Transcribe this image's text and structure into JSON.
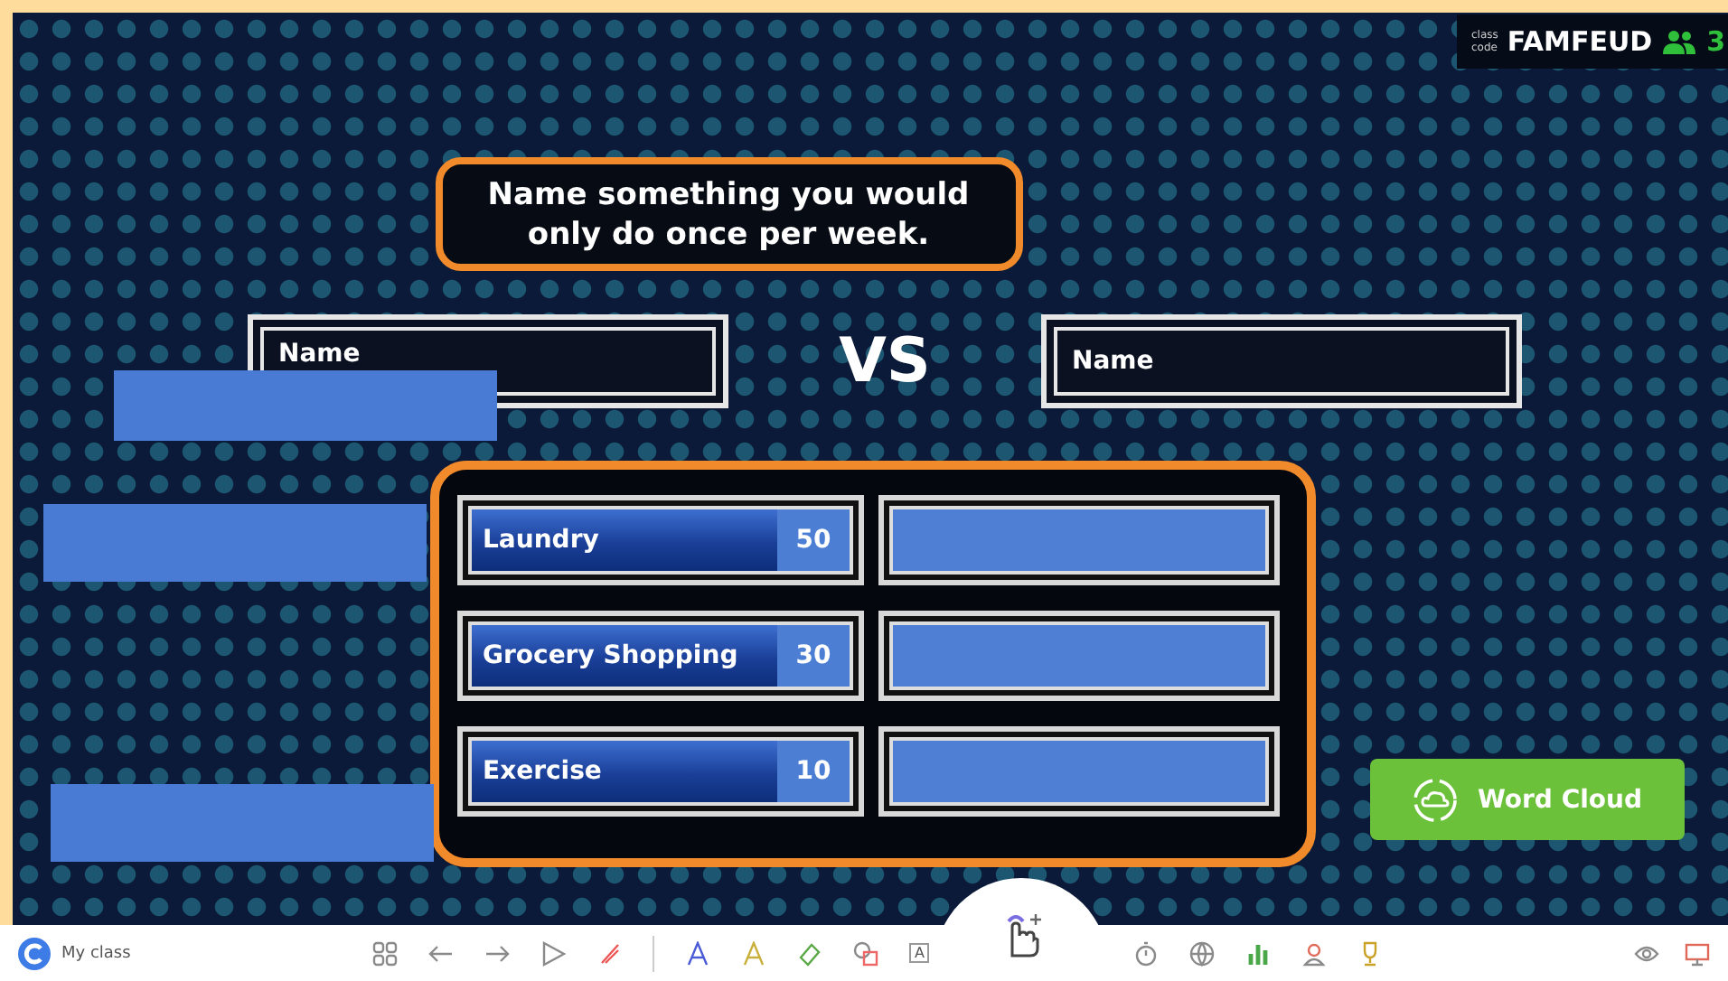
{
  "class_code": {
    "label_lines": [
      "class",
      "code"
    ],
    "code": "FAMFEUD",
    "count": "3"
  },
  "question": "Name something you would only do once per week.",
  "teams": [
    {
      "name": "Name"
    },
    {
      "name": "Name"
    }
  ],
  "vs": "VS",
  "answers": [
    {
      "text": "Laundry",
      "points": "50"
    },
    {
      "text": "Grocery Shopping",
      "points": "30"
    },
    {
      "text": "Exercise",
      "points": "10"
    }
  ],
  "word_cloud_button": "Word Cloud",
  "toolbar": {
    "class_label": "My class",
    "text_tool": "A"
  }
}
